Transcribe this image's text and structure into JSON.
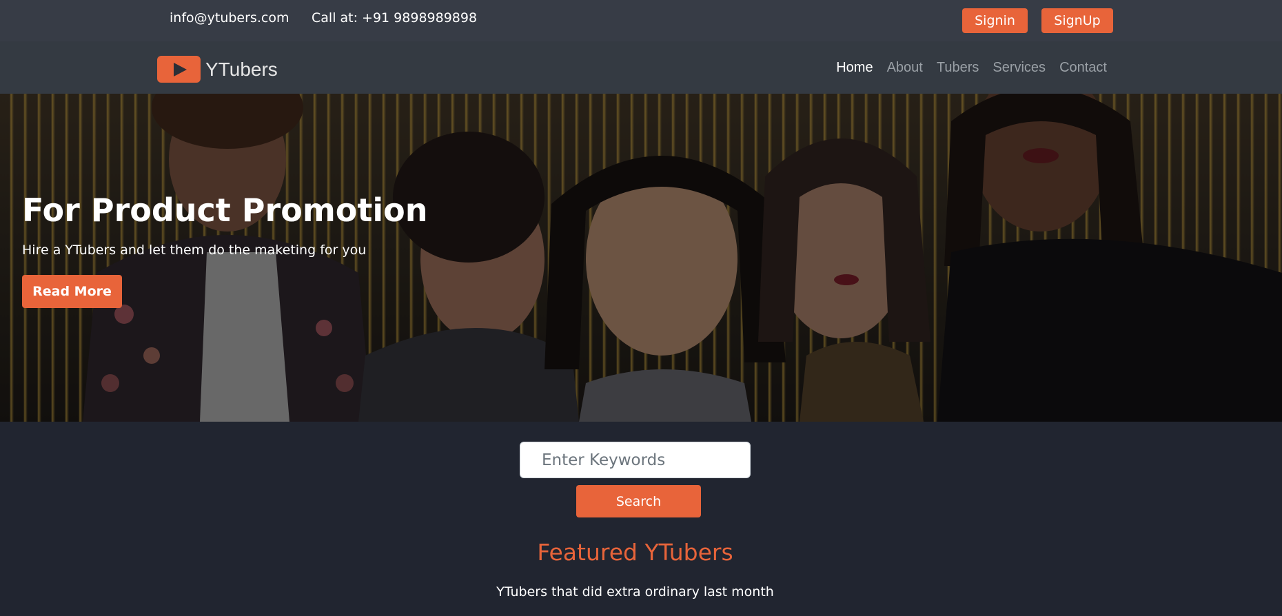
{
  "topbar": {
    "email": "info@ytubers.com",
    "phone": "Call at: +91 9898989898",
    "signin_label": "Signin",
    "signup_label": "SignUp"
  },
  "navbar": {
    "logo_text": "YTubers",
    "links": [
      {
        "label": "Home",
        "active": true
      },
      {
        "label": "About",
        "active": false
      },
      {
        "label": "Tubers",
        "active": false
      },
      {
        "label": "Services",
        "active": false
      },
      {
        "label": "Contact",
        "active": false
      }
    ]
  },
  "hero": {
    "title": "For Product Promotion",
    "subtitle": "Hire a YTubers and let them do the maketing for you",
    "button_label": "Read More"
  },
  "search": {
    "placeholder": "Enter Keywords",
    "value": "",
    "button_label": "Search"
  },
  "featured": {
    "title": "Featured YTubers",
    "subtitle": "YTubers that did extra ordinary last month"
  },
  "colors": {
    "accent": "#e8643a",
    "topbar_bg": "#373c46",
    "navbar_bg": "#343a42",
    "page_bg": "#212530"
  }
}
